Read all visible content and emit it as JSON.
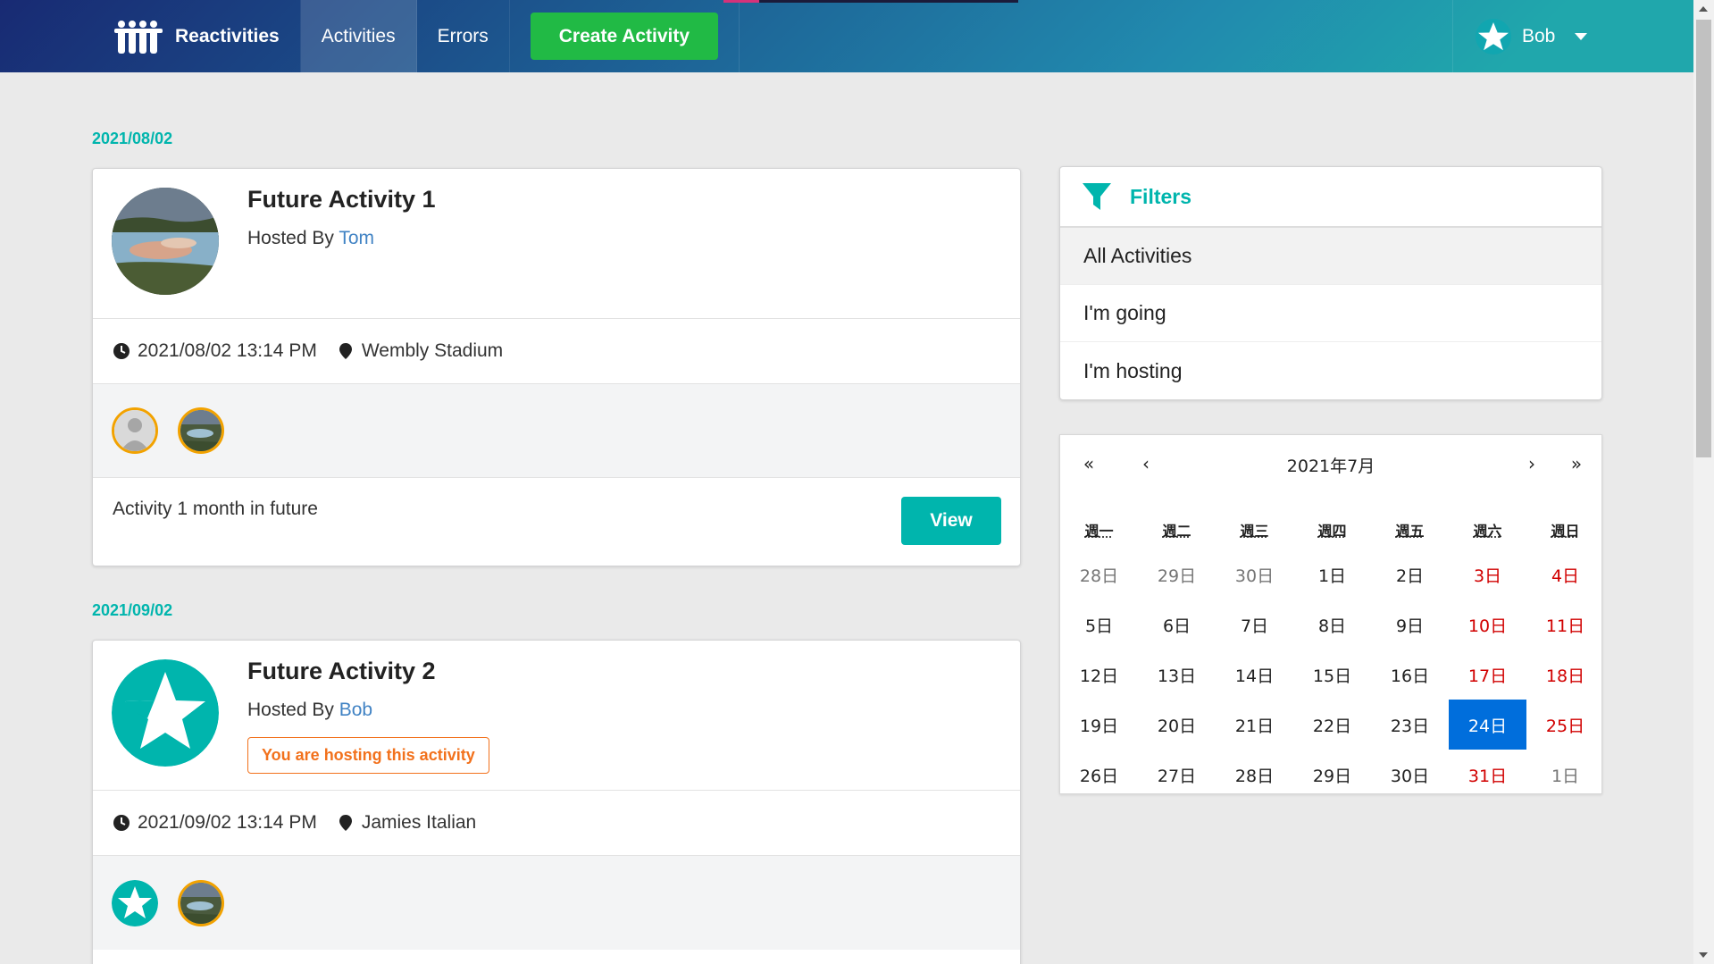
{
  "nav": {
    "brand": "Reactivities",
    "items": [
      "Activities",
      "Errors"
    ],
    "create_label": "Create Activity",
    "user_name": "Bob"
  },
  "activities": [
    {
      "date": "2021/08/02",
      "title": "Future Activity 1",
      "hosted_by_prefix": "Hosted By",
      "host": "Tom",
      "datetime": "2021/08/02 13:14 PM",
      "venue": "Wembly Stadium",
      "description": "Activity 1 month in future",
      "view_label": "View"
    },
    {
      "date": "2021/09/02",
      "title": "Future Activity 2",
      "hosted_by_prefix": "Hosted By",
      "host": "Bob",
      "host_label": "You are hosting this activity",
      "datetime": "2021/09/02 13:14 PM",
      "venue": "Jamies Italian"
    }
  ],
  "filters": {
    "title": "Filters",
    "items": [
      "All Activities",
      "I'm going",
      "I'm hosting"
    ]
  },
  "calendar": {
    "nav": [
      "«",
      "‹",
      "›",
      "»"
    ],
    "title": "2021年7月",
    "weekdays": [
      "週一",
      "週二",
      "週三",
      "週四",
      "週五",
      "週六",
      "週日"
    ],
    "weeks": [
      [
        "28日",
        "29日",
        "30日",
        "1日",
        "2日",
        "3日",
        "4日"
      ],
      [
        "5日",
        "6日",
        "7日",
        "8日",
        "9日",
        "10日",
        "11日"
      ],
      [
        "12日",
        "13日",
        "14日",
        "15日",
        "16日",
        "17日",
        "18日"
      ],
      [
        "19日",
        "20日",
        "21日",
        "22日",
        "23日",
        "24日",
        "25日"
      ],
      [
        "26日",
        "27日",
        "28日",
        "29日",
        "30日",
        "31日",
        "1日"
      ]
    ],
    "selected": "24日"
  }
}
